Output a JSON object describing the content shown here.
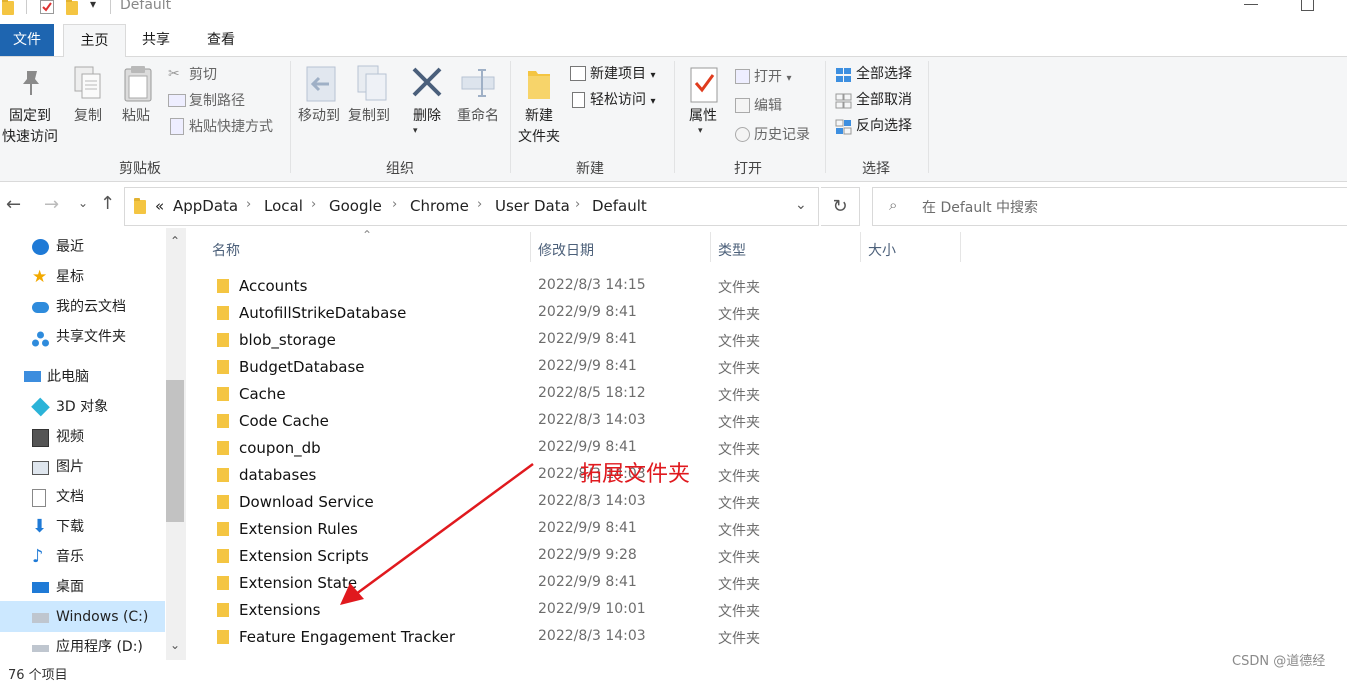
{
  "window": {
    "title": "Default"
  },
  "ribbon_tabs": [
    "文件",
    "主页",
    "共享",
    "查看"
  ],
  "ribbon": {
    "clipboard": {
      "label": "剪贴板",
      "pin": "固定到\n快速访问",
      "pin_line1": "固定到",
      "pin_line2": "快速访问",
      "copy": "复制",
      "paste": "粘贴",
      "cut": "剪切",
      "copy_path": "复制路径",
      "paste_shortcut": "粘贴快捷方式"
    },
    "organize": {
      "label": "组织",
      "move_to": "移动到",
      "copy_to": "复制到",
      "delete": "删除",
      "rename": "重命名"
    },
    "new": {
      "label": "新建",
      "new_folder_line1": "新建",
      "new_folder_line2": "文件夹",
      "new_item": "新建项目",
      "easy_access": "轻松访问"
    },
    "open": {
      "label": "打开",
      "properties": "属性",
      "open": "打开",
      "edit": "编辑",
      "history": "历史记录"
    },
    "select": {
      "label": "选择",
      "select_all": "全部选择",
      "select_none": "全部取消",
      "invert": "反向选择"
    }
  },
  "address": {
    "overflow": "«",
    "crumbs": [
      "AppData",
      "Local",
      "Google",
      "Chrome",
      "User Data",
      "Default"
    ]
  },
  "search": {
    "placeholder": "在 Default 中搜索"
  },
  "nav_pane": [
    {
      "label": "最近",
      "icon": "clock-icon",
      "color": "#1f7ad6"
    },
    {
      "label": "星标",
      "icon": "star-icon",
      "color": "#f2a900"
    },
    {
      "label": "我的云文档",
      "icon": "cloud-icon",
      "color": "#2e8bdc"
    },
    {
      "label": "共享文件夹",
      "icon": "share-icon",
      "color": "#2e8bdc"
    },
    {
      "label": "此电脑",
      "icon": "computer-icon",
      "color": "#3c8dde"
    },
    {
      "label": "3D 对象",
      "icon": "cube-icon",
      "color": "#2bb3d8"
    },
    {
      "label": "视频",
      "icon": "film-icon",
      "color": "#555"
    },
    {
      "label": "图片",
      "icon": "picture-icon",
      "color": "#555"
    },
    {
      "label": "文档",
      "icon": "document-icon",
      "color": "#777"
    },
    {
      "label": "下载",
      "icon": "download-icon",
      "color": "#1f7ad6"
    },
    {
      "label": "音乐",
      "icon": "music-icon",
      "color": "#1f7ad6"
    },
    {
      "label": "桌面",
      "icon": "desktop-icon",
      "color": "#1f7ad6"
    },
    {
      "label": "Windows (C:)",
      "icon": "drive-c-icon",
      "color": "#888"
    },
    {
      "label": "应用程序 (D:)",
      "icon": "drive-d-icon",
      "color": "#888"
    }
  ],
  "columns": [
    "名称",
    "修改日期",
    "类型",
    "大小"
  ],
  "files": [
    {
      "name": "Accounts",
      "date": "2022/8/3 14:15",
      "type": "文件夹"
    },
    {
      "name": "AutofillStrikeDatabase",
      "date": "2022/9/9 8:41",
      "type": "文件夹"
    },
    {
      "name": "blob_storage",
      "date": "2022/9/9 8:41",
      "type": "文件夹"
    },
    {
      "name": "BudgetDatabase",
      "date": "2022/9/9 8:41",
      "type": "文件夹"
    },
    {
      "name": "Cache",
      "date": "2022/8/5 18:12",
      "type": "文件夹"
    },
    {
      "name": "Code Cache",
      "date": "2022/8/3 14:03",
      "type": "文件夹"
    },
    {
      "name": "coupon_db",
      "date": "2022/9/9 8:41",
      "type": "文件夹"
    },
    {
      "name": "databases",
      "date": "2022/8/3 14:03",
      "type": "文件夹"
    },
    {
      "name": "Download Service",
      "date": "2022/8/3 14:03",
      "type": "文件夹"
    },
    {
      "name": "Extension Rules",
      "date": "2022/9/9 8:41",
      "type": "文件夹"
    },
    {
      "name": "Extension Scripts",
      "date": "2022/9/9 9:28",
      "type": "文件夹"
    },
    {
      "name": "Extension State",
      "date": "2022/9/9 8:41",
      "type": "文件夹"
    },
    {
      "name": "Extensions",
      "date": "2022/9/9 10:01",
      "type": "文件夹"
    },
    {
      "name": "Feature Engagement Tracker",
      "date": "2022/8/3 14:03",
      "type": "文件夹"
    }
  ],
  "annotation": "拓展文件夹",
  "status": "76 个项目",
  "watermark": "CSDN @道德经",
  "colors": {
    "file_tab": "#1e65b0",
    "annotation": "#e0191e",
    "folder": "#f4c542"
  }
}
